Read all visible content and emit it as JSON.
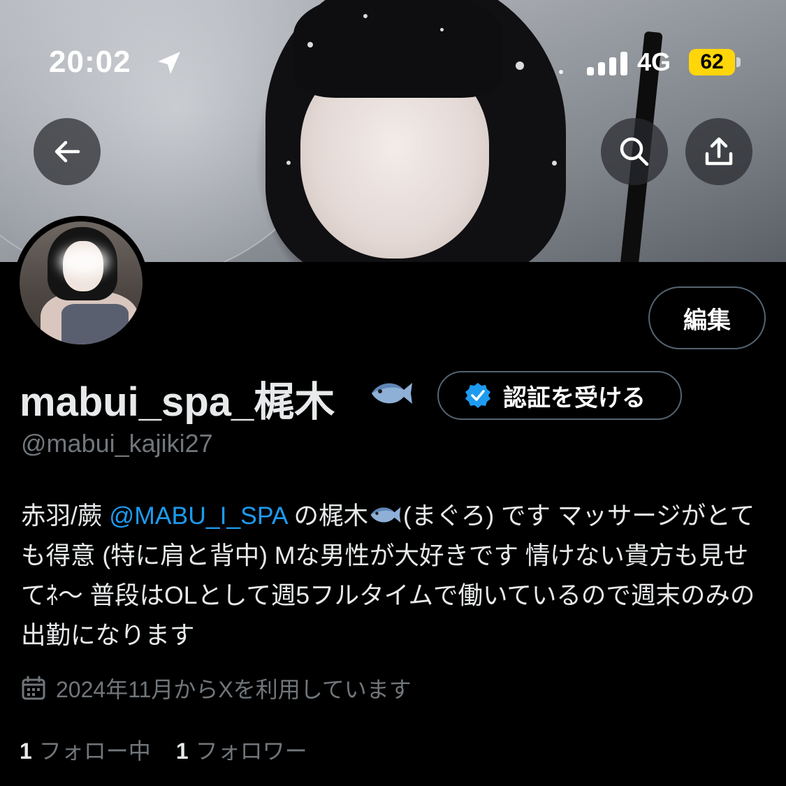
{
  "status_bar": {
    "time": "20:02",
    "network": "4G",
    "battery": "62"
  },
  "profile": {
    "edit_label": "編集",
    "display_name": "mabui_spa_梶木",
    "verify_label": "認証を受ける",
    "handle": "@mabui_kajiki27",
    "bio": {
      "part1": "赤羽/蕨 ",
      "mention": "@MABU_I_SPA",
      "part2": " の梶木",
      "part3": "(まぐろ) です マッサージがとても得意 (特に肩と背中) Mな男性が大好きです 情けない貴方も見せてﾈ〜 普段はOLとして週5フルタイムで働いているので週末のみの出勤になります"
    },
    "joined": "2024年11月からXを利用しています",
    "following_count": "1",
    "following_label": "フォロー中",
    "followers_count": "1",
    "followers_label": "フォロワー"
  },
  "icons": {
    "back": "arrow-left-icon",
    "search": "search-icon",
    "share": "share-icon",
    "verified": "verified-badge-icon",
    "calendar": "calendar-icon",
    "fish": "fish-emoji-icon",
    "location": "location-arrow-icon"
  },
  "colors": {
    "background": "#000000",
    "link": "#1d9bf0",
    "secondary_text": "#71767b",
    "border": "#536471",
    "battery": "#ffd60a"
  }
}
